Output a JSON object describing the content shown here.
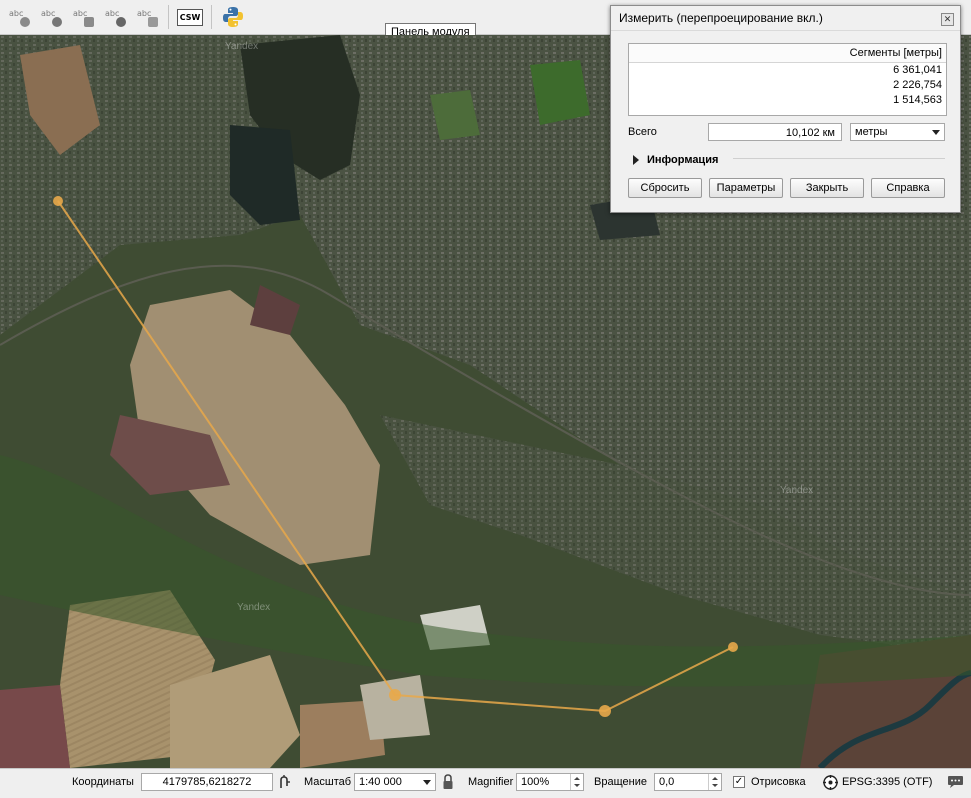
{
  "toolbar": {
    "buttons": [
      {
        "icon": "label-pin-icon",
        "text": "abc"
      },
      {
        "icon": "label-show-icon",
        "text": "abc"
      },
      {
        "icon": "label-move-icon",
        "text": "abc"
      },
      {
        "icon": "label-rotate-icon",
        "text": "abc"
      },
      {
        "icon": "label-edit-icon",
        "text": "abc"
      }
    ],
    "csw_label": "CSW",
    "python_icon": "python-icon",
    "tooltip": "Панель модуля"
  },
  "map": {
    "watermark": "Yandex",
    "measure_line_color": "#e8a84a",
    "measure_points": 5
  },
  "measure_dialog": {
    "title": "Измерить (перепроецирование вкл.)",
    "segments_header": "Сегменты [метры]",
    "segments": [
      "6 361,041",
      "2 226,754",
      "1 514,563"
    ],
    "total_label": "Всего",
    "total_value": "10,102 км",
    "units_selected": "метры",
    "info_label": "Информация",
    "buttons": {
      "reset": "Сбросить",
      "params": "Параметры",
      "close": "Закрыть",
      "help": "Справка"
    }
  },
  "statusbar": {
    "coords_label": "Координаты",
    "coords_value": "4179785,6218272",
    "scale_label": "Масштаб",
    "scale_value": "1:40 000",
    "magnifier_label": "Magnifier",
    "magnifier_value": "100%",
    "rotation_label": "Вращение",
    "rotation_value": "0,0",
    "render_label": "Отрисовка",
    "render_checked": true,
    "crs_label": "EPSG:3395 (OTF)"
  }
}
